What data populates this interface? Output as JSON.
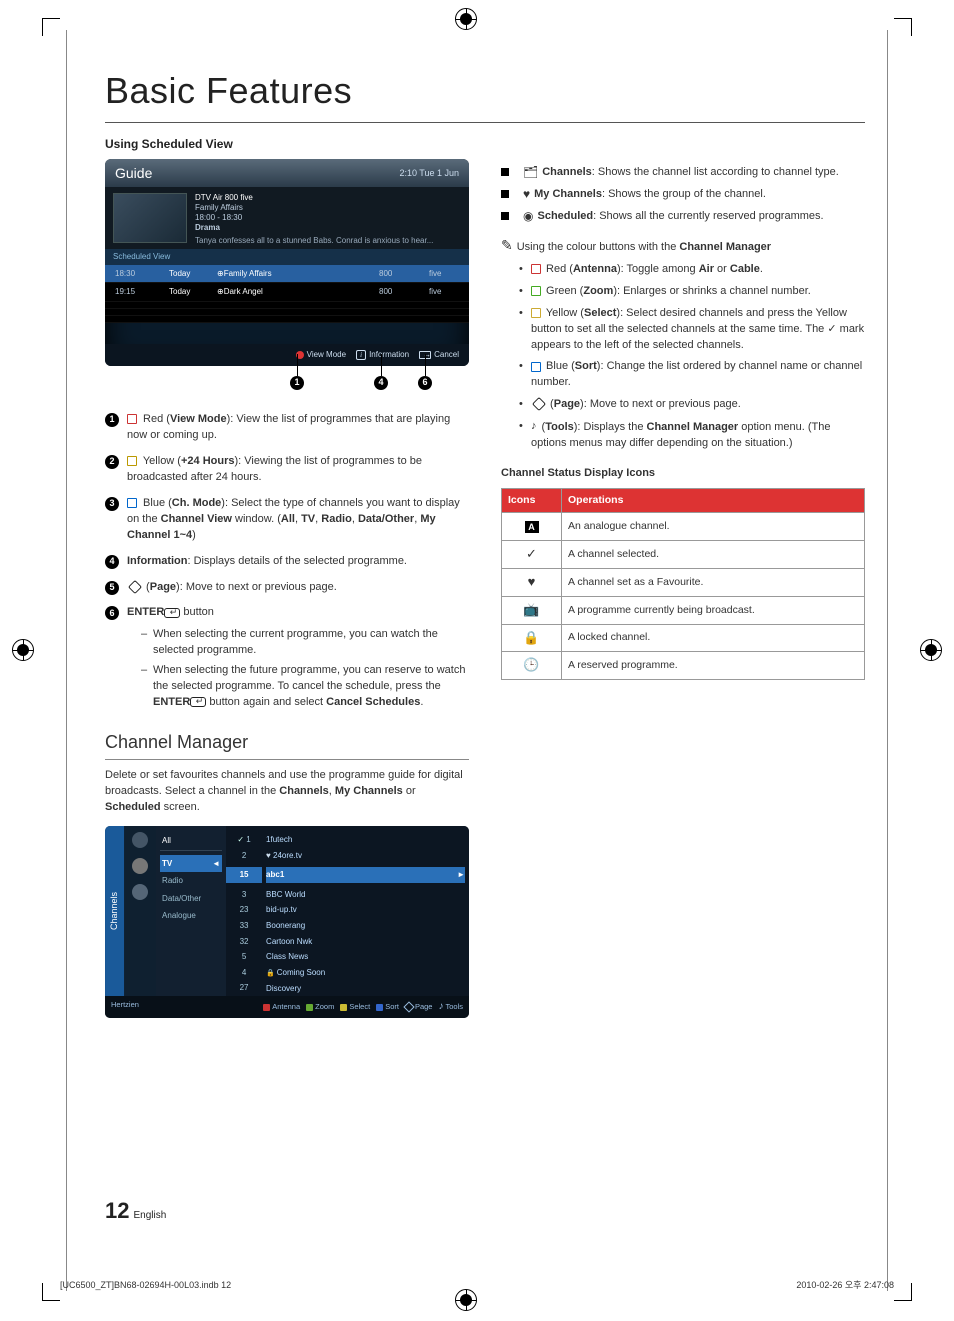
{
  "title": "Basic Features",
  "subheading": "Using Scheduled View",
  "guide": {
    "title": "Guide",
    "time": "2:10 Tue 1 Jun",
    "chline": "DTV Air 800 five",
    "prog": "Family Affairs",
    "slot": "18:00 - 18:30",
    "genre": "Drama",
    "desc": "Tanya confesses all to a stunned Babs. Conrad is anxious to hear...",
    "tab": "Scheduled View",
    "rows": [
      {
        "t": "18:30",
        "d": "Today",
        "n": "Family Affairs",
        "ch": "800",
        "cn": "five"
      },
      {
        "t": "19:15",
        "d": "Today",
        "n": "Dark Angel",
        "ch": "800",
        "cn": "five"
      }
    ],
    "foot": {
      "vm": "View Mode",
      "info": "Information",
      "cancel": "Cancel"
    }
  },
  "legend": [
    {
      "pre": "red",
      "label": "Red (View Mode)",
      "text": ": View the list of programmes that are playing now or coming up."
    },
    {
      "pre": "yel",
      "label": "Yellow (+24 Hours)",
      "text": ": Viewing the list of programmes to be broadcasted after 24 hours."
    },
    {
      "pre": "blu",
      "label": "Blue (Ch. Mode)",
      "text": ": Select the type of channels you want to display on the Channel View window. (All, TV, Radio, Data/Other, My Channel 1~4)"
    },
    {
      "pre": "",
      "label": "Information",
      "text": ": Displays details of the selected programme."
    },
    {
      "pre": "dia",
      "label": "(Page)",
      "text": ": Move to next or previous page."
    },
    {
      "pre": "ent",
      "label": "ENTER",
      "suffix": " button"
    }
  ],
  "legend6": [
    "When selecting the current programme, you can watch the selected programme.",
    "When selecting the future programme, you can reserve to watch the selected programme. To cancel the schedule, press the ENTER button again and select Cancel Schedules."
  ],
  "cm": {
    "title": "Channel Manager",
    "intro": "Delete or set favourites channels and use the programme guide for digital broadcasts. Select a channel in the Channels, My Channels or Scheduled screen.",
    "tab": "Channels",
    "types": {
      "all": "All",
      "tv": "TV",
      "radio": "Radio",
      "data": "Data/Other",
      "an": "Analogue"
    },
    "top": [
      {
        "n": "1",
        "name": "1futech",
        "chk": true
      },
      {
        "n": "2",
        "name": "24ore.tv",
        "heart": true
      }
    ],
    "sel": {
      "n": "15",
      "name": "abc1"
    },
    "rows": [
      {
        "n": "3",
        "name": "BBC World"
      },
      {
        "n": "23",
        "name": "bid-up.tv"
      },
      {
        "n": "33",
        "name": "Boonerang"
      },
      {
        "n": "32",
        "name": "Cartoon Nwk"
      },
      {
        "n": "5",
        "name": "Class News"
      },
      {
        "n": "4",
        "name": "Coming Soon",
        "lock": true
      },
      {
        "n": "27",
        "name": "Discovery"
      }
    ],
    "foot": {
      "src": "Hertzien",
      "a": "Antenna",
      "z": "Zoom",
      "s": "Select",
      "so": "Sort",
      "p": "Page",
      "t": "Tools"
    }
  },
  "right_blocks": [
    {
      "icon": "channels",
      "label": "Channels",
      "text": ": Shows the channel list according to channel type."
    },
    {
      "icon": "heart",
      "label": "My Channels",
      "text": ": Shows the group of the channel."
    },
    {
      "icon": "sched",
      "label": "Scheduled",
      "text": ": Shows all the currently reserved programmes."
    }
  ],
  "note_intro": "Using the colour buttons with the Channel Manager",
  "colour_notes": [
    {
      "c": "r",
      "label": "Red (Antenna)",
      "text": ": Toggle among Air or Cable."
    },
    {
      "c": "g",
      "label": "Green (Zoom)",
      "text": ": Enlarges or shrinks a channel number."
    },
    {
      "c": "y",
      "label": "Yellow (Select)",
      "text": ": Select desired channels and press the Yellow button to set all the selected channels at the same time. The ✓ mark appears to the left of the selected channels."
    },
    {
      "c": "b",
      "label": "Blue (Sort)",
      "text": ": Change the list ordered by channel name or channel number."
    },
    {
      "c": "dia",
      "label": "(Page)",
      "text": ": Move to next or previous page."
    },
    {
      "c": "tool",
      "label": "(Tools)",
      "text": ": Displays the Channel Manager option menu. (The options menus may differ depending on the situation.)"
    }
  ],
  "table_title": "Channel Status Display Icons",
  "table_head": {
    "c1": "Icons",
    "c2": "Operations"
  },
  "table_rows": [
    {
      "i": "A",
      "t": "An analogue channel."
    },
    {
      "i": "chk",
      "t": "A channel selected."
    },
    {
      "i": "heart",
      "t": "A channel set as a Favourite."
    },
    {
      "i": "tv",
      "t": "A programme currently being broadcast."
    },
    {
      "i": "lock",
      "t": "A locked channel."
    },
    {
      "i": "clock",
      "t": "A reserved programme."
    }
  ],
  "pagenum": "12",
  "pagelang": "English",
  "footer": {
    "left": "[UC6500_ZT]BN68-02694H-00L03.indb   12",
    "right": "2010-02-26   오후 2:47:08"
  }
}
